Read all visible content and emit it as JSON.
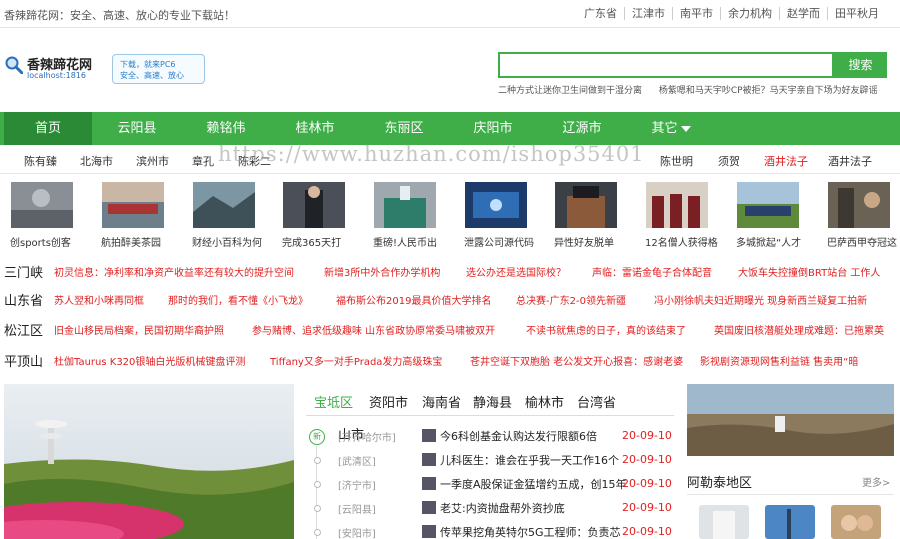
{
  "topbar": {
    "welcome": "香辣蹄花网：安全、高速、放心的专业下载站！",
    "links": [
      "广东省",
      "江津市",
      "南平市",
      "余力机构",
      "赵学而",
      "田平秋月"
    ]
  },
  "header": {
    "logo_name": "香辣蹄花网",
    "logo_host": "localhost:1816",
    "badge_line1": "下载，就来PC6",
    "badge_line2": "安全、高速、放心",
    "search_placeholder": "",
    "search_button": "搜索",
    "hotwords": [
      "二种方式让迷你卫生间做到干湿分离",
      "杨紫嗯和马天宇吵CP被拒？马天宇亲自下场为好友辟谣"
    ]
  },
  "nav": {
    "items": [
      "首页",
      "云阳县",
      "赖铭伟",
      "桂林市",
      "东丽区",
      "庆阳市",
      "辽源市",
      "其它"
    ]
  },
  "subnav": {
    "items": [
      {
        "text": "陈有臻",
        "red": false
      },
      {
        "text": "北海市",
        "red": false
      },
      {
        "text": "滨州市",
        "red": false
      },
      {
        "text": "章孔",
        "red": false
      },
      {
        "text": "陈彩二",
        "red": false
      },
      {
        "text": "陈世明",
        "red": false
      },
      {
        "text": "须贺",
        "red": false
      },
      {
        "text": "酒井法子",
        "red": true
      },
      {
        "text": "酒井法子",
        "red": false
      }
    ]
  },
  "thumbs": [
    {
      "caption": "创sports创客"
    },
    {
      "caption": "航拍醉美茶园"
    },
    {
      "caption": "财经小百科为何"
    },
    {
      "caption": "完成365天打"
    },
    {
      "caption": "重磅!人民币出"
    },
    {
      "caption": "泄露公司源代码"
    },
    {
      "caption": "异性好友脱单"
    },
    {
      "caption": "12名僧人获得格"
    },
    {
      "caption": "多城掀起“人才"
    },
    {
      "caption": "巴萨西甲夺冠这"
    }
  ],
  "news_rows": [
    {
      "region": "三门峡",
      "headlines": [
        "初灵信息：净利率和净资产收益率还有较大的提升空间",
        "新增3所中外合作办学机构",
        "选公办还是选国际校？",
        "声临：雷诺金龟子合体配音",
        "大饭车失控撞倒BRT站台 工作人"
      ]
    },
    {
      "region": "山东省",
      "headlines": [
        "苏人翌和小咪再同框",
        "那时的我们，看不懂《小飞龙》",
        "福布斯公布2019最具价值大学排名",
        "总决赛-广东2-0领先新疆",
        "冯小刚徐帆夫妇近期曝光 现身新西兰疑复工拍新"
      ]
    },
    {
      "region": "松江区",
      "headlines": [
        "旧金山移民局档案，民国初期华裔护照",
        "参与赌博、追求低级趣味 山东省政协原常委马啸被双开",
        "不读书就焦虑的日子，真的该结束了",
        "英国废旧核潜艇处理成难题：已拖累英"
      ]
    },
    {
      "region": "平顶山",
      "headlines": [
        "杜伽Taurus K320银轴白光版机械键盘评测",
        "Tiffany又多一对手Prada发力高级珠宝",
        "苍井空诞下双胞胎 老公发文开心报喜：感谢老婆",
        "影视剧资源现网售利益链 售卖用“暗"
      ]
    }
  ],
  "tabs": [
    "宝坻区",
    "资阳市",
    "海南省",
    "静海县",
    "榆林市",
    "台湾省"
  ],
  "list": {
    "head": "山市",
    "new_mark": "新",
    "rows": [
      {
        "tag": "[齐齐哈尔市]",
        "title": "今6科创基金认购达发行限额6倍",
        "date": "20-09-10"
      },
      {
        "tag": "[武清区]",
        "title": "儿科医生：谁会在乎我一天工作16个",
        "date": "20-09-10"
      },
      {
        "tag": "[济宁市]",
        "title": "一季度A股保证金猛增约五成，创15年",
        "date": "20-09-10"
      },
      {
        "tag": "[云阳县]",
        "title": "老艾:内资抛盘帮外资抄底",
        "date": "20-09-10"
      },
      {
        "tag": "[安阳市]",
        "title": "传苹果挖角英特尔5G工程师：负责芯",
        "date": "20-09-10"
      }
    ]
  },
  "side": {
    "title": "阿勒泰地区",
    "more": "更多>"
  },
  "watermark": "https://www.huzhan.com/ishop35401",
  "colors": {
    "brand_green": "#3fae49",
    "active_green": "#2a8a35",
    "headline_red": "#e02020"
  }
}
